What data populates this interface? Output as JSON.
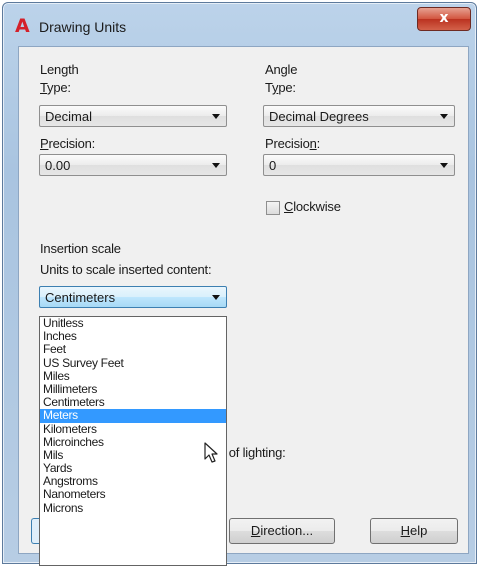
{
  "window": {
    "title": "Drawing Units",
    "close_label": "x"
  },
  "length": {
    "group_label": "Length",
    "type_label": {
      "prefix": "",
      "accel": "T",
      "rest": "ype:"
    },
    "type_value": "Decimal",
    "precision_label": {
      "prefix": "",
      "accel": "P",
      "rest": "recision:"
    },
    "precision_value": "0.00"
  },
  "angle": {
    "group_label": "Angle",
    "type_label": {
      "prefix": "T",
      "accel": "y",
      "rest": "pe:"
    },
    "type_value": "Decimal Degrees",
    "precision_label": {
      "prefix": "Precisio",
      "accel": "n",
      "rest": ":"
    },
    "precision_value": "0",
    "clockwise_label": {
      "prefix": "",
      "accel": "C",
      "rest": "lockwise"
    },
    "clockwise_checked": false
  },
  "insertion": {
    "group_label": "Insertion scale",
    "units_label": "Units to scale inserted content:",
    "selected_value": "Centimeters",
    "options": [
      "Unitless",
      "Inches",
      "Feet",
      "US Survey Feet",
      "Miles",
      "Millimeters",
      "Centimeters",
      "Meters",
      "Kilometers",
      "Microinches",
      "Mils",
      "Yards",
      "Angstroms",
      "Nanometers",
      "Microns"
    ],
    "highlighted_option": "Meters"
  },
  "lighting_label_fragment": "y of lighting:",
  "buttons": {
    "direction": {
      "prefix": "",
      "accel": "D",
      "rest": "irection..."
    },
    "help": {
      "prefix": "",
      "accel": "H",
      "rest": "elp"
    }
  },
  "colors": {
    "title_accent": "#d4202a",
    "selection": "#3399ff",
    "close_button": "#c94430"
  },
  "icons": {
    "app": "autocad-a-icon",
    "close": "close-icon",
    "cursor": "mouse-pointer-icon"
  }
}
